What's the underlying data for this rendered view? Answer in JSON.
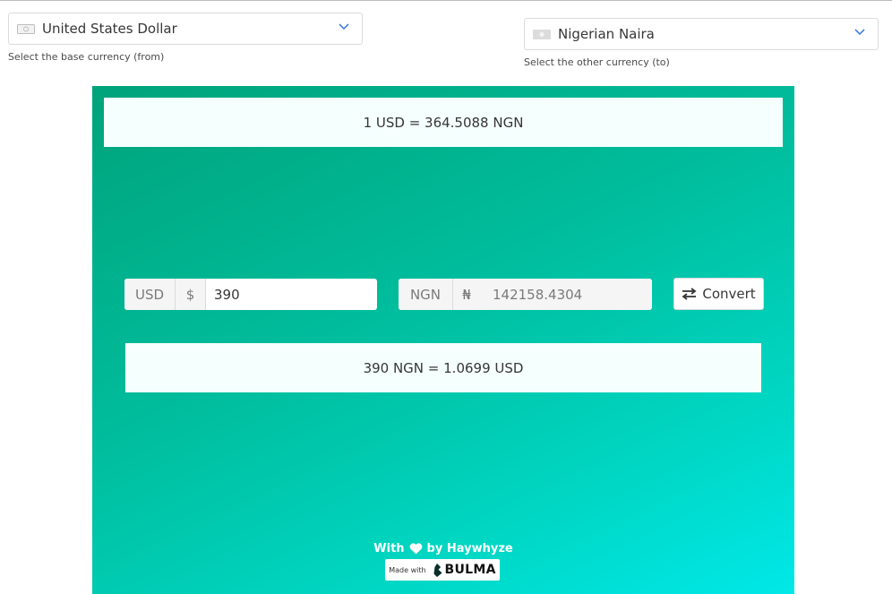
{
  "from_select": {
    "value": "United States Dollar",
    "helper": "Select the base currency (from)",
    "icon": "money-bill-icon"
  },
  "to_select": {
    "value": "Nigerian Naira",
    "helper": "Select the other currency (to)",
    "icon": "money-bill-icon"
  },
  "rate_top": "1 USD = 364.5088 NGN",
  "from_field": {
    "currency_code": "USD",
    "symbol": "$",
    "value": "390"
  },
  "to_field": {
    "currency_code": "NGN",
    "symbol": "₦",
    "value": "142158.4304"
  },
  "convert_button": {
    "label": "Convert",
    "icon": "exchange-arrows-icon"
  },
  "rate_bottom": "390 NGN = 1.0699 USD",
  "footer": {
    "with": "With",
    "by": "by Haywhyze",
    "made_with": "Made with",
    "brand": "BULMA"
  },
  "colors": {
    "gradient_start": "#00a37a",
    "gradient_end": "#00e8e8",
    "accent": "#3273dc"
  }
}
